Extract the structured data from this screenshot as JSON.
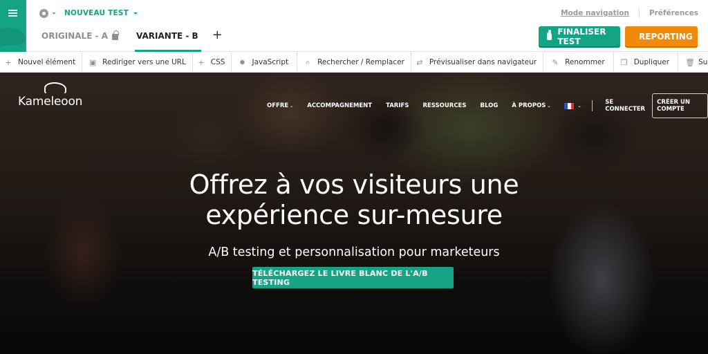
{
  "colors": {
    "brand_green": "#14a384",
    "reporting_orange": "#f18a0b",
    "tab_inactive": "#8f8f8f"
  },
  "editor": {
    "sidebar_toggle_icon": "hamburger-icon",
    "settings_icon": "gear-icon",
    "test_name": "NOUVEAU TEST",
    "tabs": [
      {
        "label": "ORIGINALE - A",
        "locked": true,
        "active": false
      },
      {
        "label": "VARIANTE - B",
        "locked": false,
        "active": true
      }
    ],
    "add_variant_label": "+",
    "top_links": {
      "mode_navigation": "Mode navigation",
      "preferences": "Préférences"
    },
    "buttons": {
      "finalize": "FINALISER TEST",
      "reporting": "REPORTING"
    }
  },
  "toolbar": {
    "items": [
      {
        "icon": "plus-icon",
        "label": "Nouvel élément"
      },
      {
        "icon": "url-redirect-icon",
        "label": "Rediriger vers une URL"
      },
      {
        "icon": "plus-icon",
        "label": "CSS"
      },
      {
        "icon": "gear-icon",
        "label": "JavaScript"
      },
      {
        "icon": "search-replace-icon",
        "label": "Rechercher / Remplacer"
      },
      {
        "icon": "preview-icon",
        "label": "Prévisualiser dans navigateur"
      },
      {
        "icon": "pencil-icon",
        "label": "Renommer"
      },
      {
        "icon": "duplicate-icon",
        "label": "Dupliquer"
      },
      {
        "icon": "trash-icon",
        "label": "Supprimer"
      }
    ]
  },
  "site": {
    "logo_text": "Kameleoon",
    "nav": [
      {
        "label": "OFFRE",
        "dropdown": true
      },
      {
        "label": "ACCOMPAGNEMENT",
        "dropdown": false
      },
      {
        "label": "TARIFS",
        "dropdown": false
      },
      {
        "label": "RESSOURCES",
        "dropdown": false
      },
      {
        "label": "BLOG",
        "dropdown": false
      },
      {
        "label": "À PROPOS",
        "dropdown": true
      }
    ],
    "language": "FR",
    "login": "SE CONNECTER",
    "signup": "CRÉER UN COMPTE",
    "hero": {
      "title_line1": "Offrez à vos visiteurs une",
      "title_line2": "expérience sur-mesure",
      "subtitle": "A/B testing et personnalisation pour marketeurs",
      "cta": "TÉLÉCHARGEZ LE LIVRE BLANC DE L'A/B TESTING"
    }
  }
}
